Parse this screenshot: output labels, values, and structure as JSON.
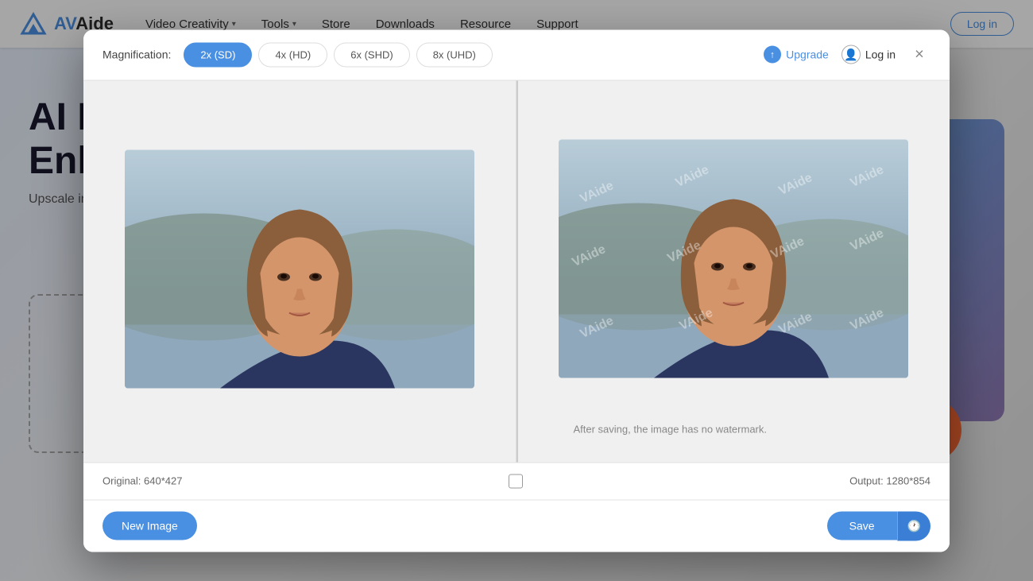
{
  "logo": {
    "text_av": "AV",
    "text_aide": "Aide",
    "full": "AVAide"
  },
  "navbar": {
    "items": [
      {
        "id": "video-creativity",
        "label": "Video Creativity",
        "has_dropdown": true
      },
      {
        "id": "tools",
        "label": "Tools",
        "has_dropdown": true
      },
      {
        "id": "store",
        "label": "Store",
        "has_dropdown": false
      },
      {
        "id": "downloads",
        "label": "Downloads",
        "has_dropdown": false
      },
      {
        "id": "resource",
        "label": "Resource",
        "has_dropdown": false
      },
      {
        "id": "support",
        "label": "Support",
        "has_dropdown": false
      }
    ],
    "login_label": "Log in"
  },
  "hero": {
    "title_line1": "AI I",
    "title_line2": "Enla",
    "subtitle": "Upscale images without blurry..."
  },
  "modal": {
    "magnification_label": "Magnification:",
    "mag_options": [
      {
        "id": "2x",
        "label": "2x (SD)",
        "active": true
      },
      {
        "id": "4x",
        "label": "4x (HD)",
        "active": false
      },
      {
        "id": "6x",
        "label": "6x (SHD)",
        "active": false
      },
      {
        "id": "8x",
        "label": "8x (UHD)",
        "active": false
      }
    ],
    "upgrade_label": "Upgrade",
    "login_label": "Log in",
    "original_info": "Original: 640*427",
    "output_info": "Output: 1280*854",
    "watermark_text": "After saving, the image has no watermark.",
    "watermark_brand": "VAide",
    "new_image_label": "New Image",
    "save_label": "Save",
    "close_icon": "×"
  }
}
